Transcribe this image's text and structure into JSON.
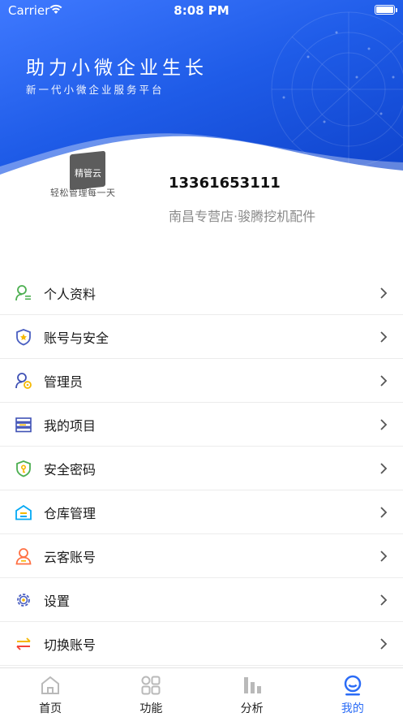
{
  "status_bar": {
    "carrier": "Carrier",
    "time": "8:08 PM"
  },
  "banner": {
    "headline": "助力小微企业生长",
    "subline": "新一代小微企业服务平台"
  },
  "profile": {
    "logo_text": "精管云",
    "slogan": "轻松管理每一天",
    "phone": "13361653111",
    "store": "南昌专营店·骏腾挖机配件"
  },
  "menu": [
    {
      "label": "个人资料",
      "icon": "person-profile-icon",
      "color": "#4caf50"
    },
    {
      "label": "账号与安全",
      "icon": "shield-icon",
      "color": "#4a5fc1"
    },
    {
      "label": "管理员",
      "icon": "admin-user-icon",
      "color": "#3f51b5"
    },
    {
      "label": "我的项目",
      "icon": "server-stack-icon",
      "color": "#3f51b5"
    },
    {
      "label": "安全密码",
      "icon": "shield-key-icon",
      "color": "#4caf50"
    },
    {
      "label": "仓库管理",
      "icon": "warehouse-icon",
      "color": "#03a9f4"
    },
    {
      "label": "云客账号",
      "icon": "customer-icon",
      "color": "#ff7043"
    },
    {
      "label": "设置",
      "icon": "gear-icon",
      "color": "#4a5fc1"
    },
    {
      "label": "切换账号",
      "icon": "switch-arrows-icon",
      "color": "#f44336"
    }
  ],
  "tabs": [
    {
      "label": "首页",
      "icon": "home-icon",
      "active": false
    },
    {
      "label": "功能",
      "icon": "grid-icon",
      "active": false
    },
    {
      "label": "分析",
      "icon": "bar-chart-icon",
      "active": false
    },
    {
      "label": "我的",
      "icon": "me-icon",
      "active": true
    }
  ],
  "colors": {
    "accent": "#2b6cf6",
    "header_start": "#3f79ff",
    "header_end": "#0c3fc7"
  }
}
